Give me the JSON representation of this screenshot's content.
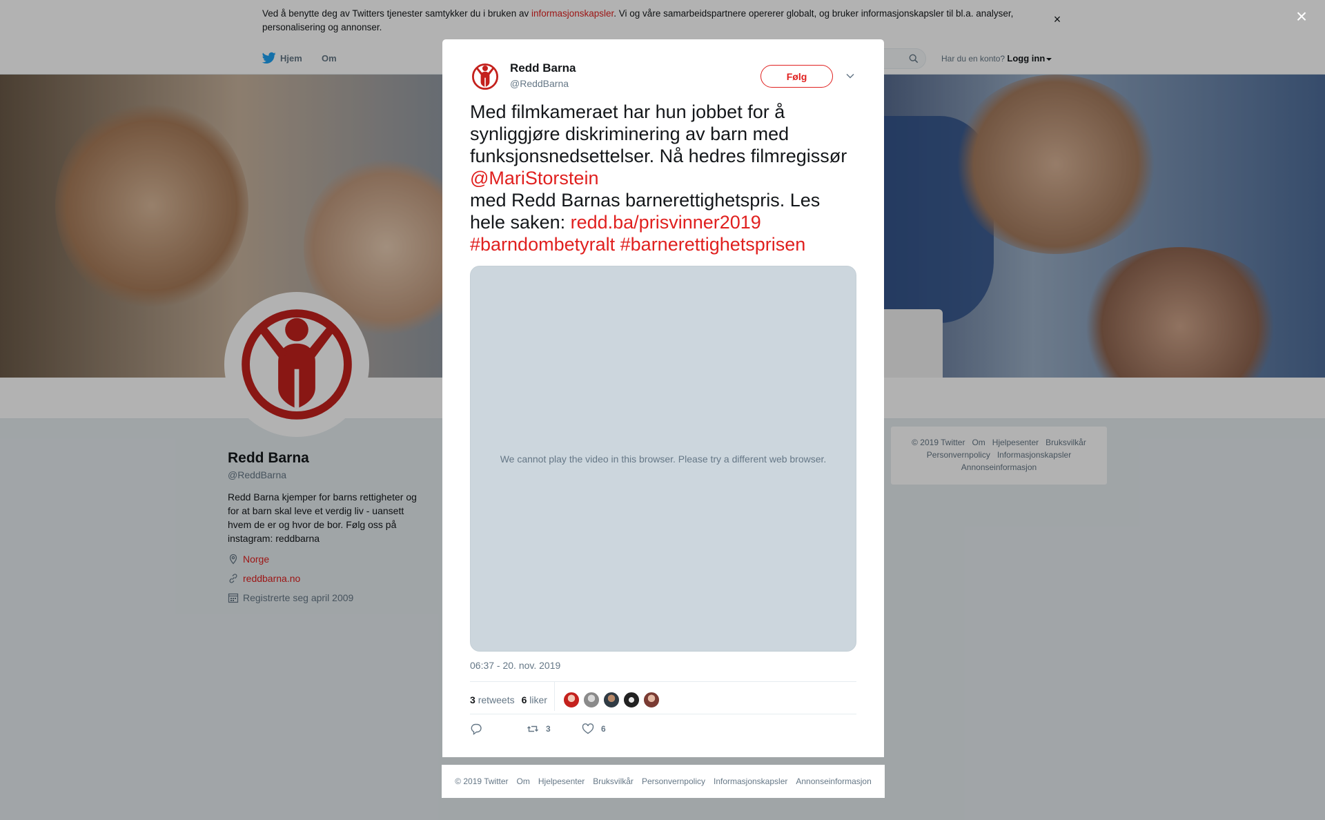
{
  "cookie_banner": {
    "text_before": "Ved å benytte deg av Twitters tjenester samtykker du i bruken av ",
    "link": "informasjonskapsler",
    "text_after": ". Vi og våre samarbeidspartnere opererer globalt, og bruker informasjonskapsler til bl.a. analyser, personalisering og annonser.",
    "close": "×"
  },
  "nav": {
    "home": "Hjem",
    "about": "Om",
    "account_prompt": "Har du en konto?",
    "login": "Logg inn"
  },
  "profile": {
    "name": "Redd Barna",
    "handle": "@ReddBarna",
    "bio": "Redd Barna kjemper for barns rettigheter og for at barn skal leve et verdig liv - uansett hvem de er og hvor de bor. Følg oss på instagram: reddbarna",
    "location": "Norge",
    "website": "reddbarna.no",
    "joined": "Registrerte seg april 2009"
  },
  "side_footer": {
    "line1": [
      "© 2019 Twitter",
      "Om",
      "Hjelpesenter",
      "Bruksvilkår"
    ],
    "line2": [
      "Personvernpolicy",
      "Informasjonskapsler"
    ],
    "line3": [
      "Annonseinformasjon"
    ]
  },
  "overlay_close": "×",
  "tweet": {
    "author_name": "Redd Barna",
    "author_handle": "@ReddBarna",
    "follow_label": "Følg",
    "text_1": "Med filmkameraet har hun jobbet for å synliggjøre diskriminering av barn med funksjonsnedsettelser. Nå hedres filmregissør",
    "mention": "@MariStorstein",
    "text_2": "med Redd Barnas barnerettighetspris. Les hele saken: ",
    "url": "redd.ba/prisvinner2019",
    "hashtag_1": "#barndombetyralt",
    "hashtag_2": "#barnerettighetsprisen",
    "video_message": "We cannot play the video in this browser. Please try a different web browser.",
    "timestamp": "06:37 - 20. nov. 2019",
    "retweets_count": "3",
    "retweets_label": "retweets",
    "likes_count": "6",
    "likes_label": "liker",
    "action_retweet_count": "3",
    "action_like_count": "6"
  },
  "modal_footer": [
    "© 2019 Twitter",
    "Om",
    "Hjelpesenter",
    "Bruksvilkår",
    "Personvernpolicy",
    "Informasjonskapsler",
    "Annonseinformasjon"
  ],
  "colors": {
    "accent": "#e0201f",
    "twitter_blue": "#1da1f2",
    "muted": "#657786",
    "video_bg": "#ccd6dd"
  },
  "icons": [
    "twitter-bird-icon",
    "search-icon",
    "location-icon",
    "link-icon",
    "calendar-icon",
    "chevron-down-icon",
    "reply-icon",
    "retweet-icon",
    "like-icon",
    "close-icon"
  ]
}
